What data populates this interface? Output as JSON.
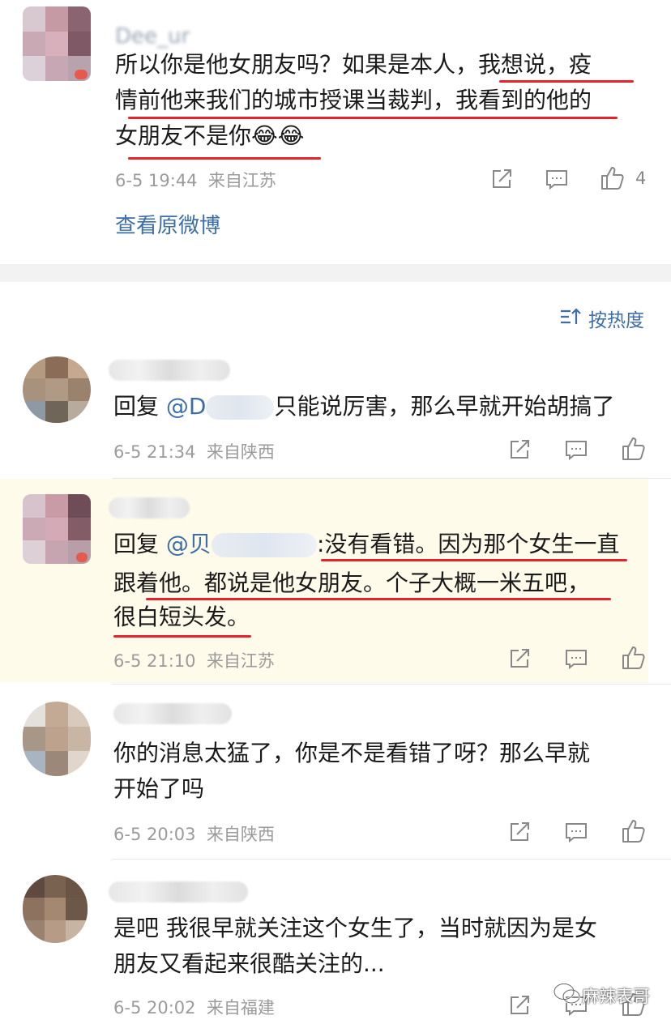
{
  "top_comment": {
    "name": "Dee_ur",
    "text_lines": [
      "所以你是他女朋友吗？如果是本人，我想说，疫",
      "情前他来我们的城市授课当裁判，我看到的他的",
      "女朋友不是你"
    ],
    "emoji": [
      "😂",
      "😂"
    ],
    "time": "6-5 19:44",
    "location": "来自江苏",
    "like_count": "4",
    "view_original": "查看原微博"
  },
  "sort": {
    "label": "按热度",
    "icon": "sort-icon"
  },
  "comments": [
    {
      "reply_prefix": "回复",
      "mention": "@D",
      "text": "只能说厉害，那么早就开始胡搞了",
      "time": "6-5 21:34",
      "location": "来自陕西"
    },
    {
      "reply_prefix": "回复",
      "mention": "@贝",
      "text_lines": [
        ":没有看错。因为那个女生一直",
        "跟着他。都说是他女朋友。个子大概一米五吧，",
        "很白短头发。"
      ],
      "time": "6-5 21:10",
      "location": "来自江苏"
    },
    {
      "text_lines": [
        "你的消息太猛了，你是不是看错了呀？那么早就",
        "开始了吗"
      ],
      "time": "6-5 20:03",
      "location": "来自陕西"
    },
    {
      "text_lines": [
        "是吧 我很早就关注这个女生了，当时就因为是女",
        "朋友又看起来很酷关注的..."
      ],
      "time": "6-5 20:02",
      "location": "来自福建"
    }
  ],
  "watermark": "麻辣表哥",
  "colors": {
    "accent_red": "#e8212b",
    "link_blue": "#3d6ea8",
    "highlight_bg": "#fffbeb",
    "meta_gray": "#9b9b9b"
  }
}
